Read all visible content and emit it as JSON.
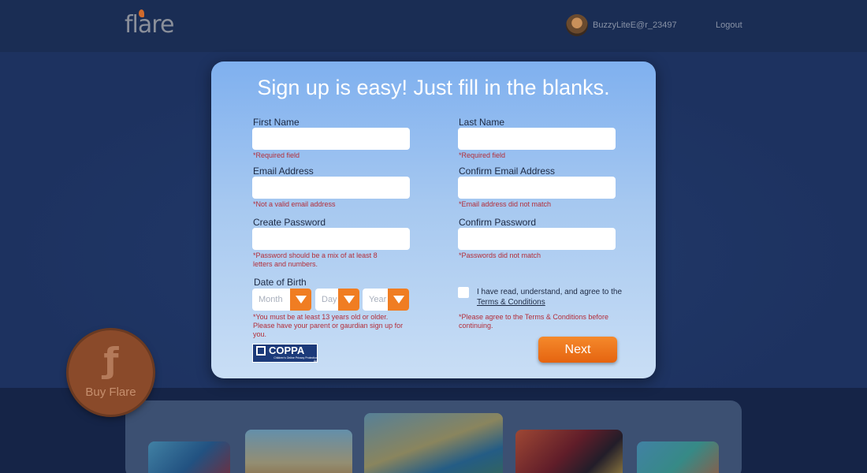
{
  "header": {
    "logo_text": "flare",
    "username": "BuzzyLiteE@r_23497",
    "logout_label": "Logout"
  },
  "buy_flare": {
    "label": "Buy Flare"
  },
  "signup": {
    "title": "Sign up is easy! Just fill in the blanks.",
    "first_name": {
      "label": "First Name",
      "value": "",
      "error": "*Required field"
    },
    "last_name": {
      "label": "Last Name",
      "value": "",
      "error": "*Required field"
    },
    "email": {
      "label": "Email Address",
      "value": "",
      "error": "*Not a valid email address"
    },
    "confirm_email": {
      "label": "Confirm Email Address",
      "value": "",
      "error": "*Email address did not match"
    },
    "password": {
      "label": "Create Password",
      "value": "",
      "error": "*Password should be a mix of at least 8 letters and numbers."
    },
    "confirm_password": {
      "label": "Confirm Password",
      "value": "",
      "error": "*Passwords did not match"
    },
    "dob": {
      "label": "Date of Birth",
      "month_placeholder": "Month",
      "day_placeholder": "Day",
      "year_placeholder": "Year",
      "error": "*You must be at least 13 years old or older. Please have your parent or gaurdian sign up for you."
    },
    "terms": {
      "text": "I have read, understand, and agree to the",
      "link": "Terms & Conditions",
      "error": "*Please agree to the Terms & Conditions before continuing."
    },
    "coppa": {
      "title": "COPPA",
      "subtitle": "Children's Online Privacy Protection Act"
    },
    "next_label": "Next"
  },
  "colors": {
    "accent_orange": "#f07d22",
    "error_red": "#b32e3a",
    "dialog_top": "#7fb0ef"
  }
}
